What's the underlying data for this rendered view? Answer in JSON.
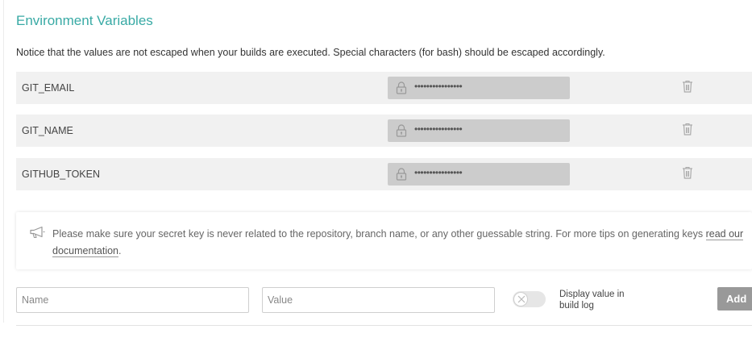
{
  "section": {
    "title": "Environment Variables",
    "notice": "Notice that the values are not escaped when your builds are executed. Special characters (for bash) should be escaped accordingly."
  },
  "variables": [
    {
      "name": "GIT_EMAIL",
      "masked_value": "••••••••••••••••",
      "value_icon": "lock-icon",
      "delete_icon": "trash-icon"
    },
    {
      "name": "GIT_NAME",
      "masked_value": "••••••••••••••••",
      "value_icon": "lock-icon",
      "delete_icon": "trash-icon"
    },
    {
      "name": "GITHUB_TOKEN",
      "masked_value": "••••••••••••••••",
      "value_icon": "lock-icon",
      "delete_icon": "trash-icon"
    }
  ],
  "tip": {
    "icon": "megaphone-icon",
    "text": "Please make sure your secret key is never related to the repository, branch name, or any other guessable string. For more tips on generating keys",
    "link_text": "read our documentation",
    "trailing": "."
  },
  "form": {
    "name_placeholder": "Name",
    "name_value": "",
    "value_placeholder": "Value",
    "value_value": "",
    "toggle_label": "Display value in build log",
    "toggle_state": "off",
    "add_label": "Add"
  },
  "colors": {
    "title": "#39aaa5",
    "row_background": "#f1f1f1",
    "masked_value_background": "#cccccc",
    "add_button": "#999999"
  }
}
